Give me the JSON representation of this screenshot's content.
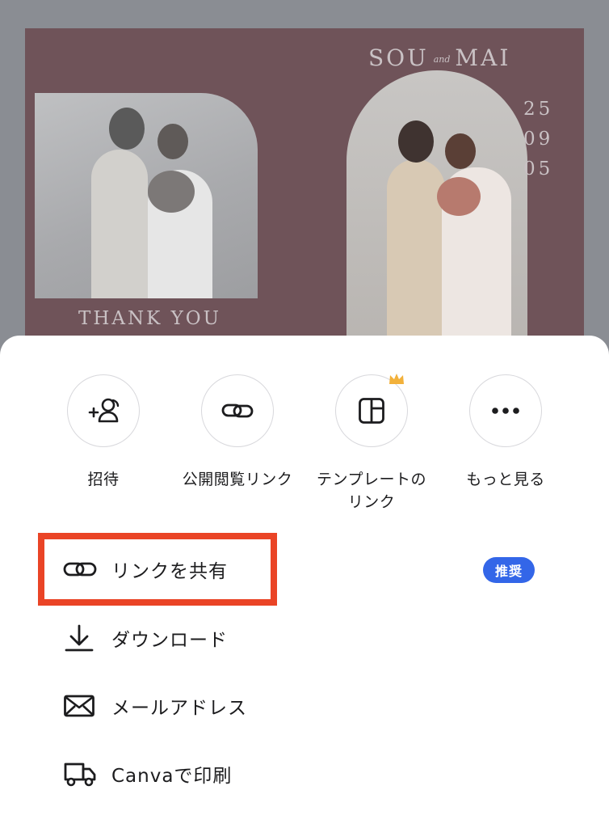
{
  "preview": {
    "names_left": "SOU",
    "names_and": "and",
    "names_right": "MAI",
    "date": "25\n09\n05",
    "thanks": "THANK YOU"
  },
  "share_targets": [
    {
      "label": "招待",
      "icon": "invite-person-icon"
    },
    {
      "label": "公開閲覧リンク",
      "icon": "link-icon"
    },
    {
      "label": "テンプレートの\nリンク",
      "icon": "template-icon",
      "premium": true
    },
    {
      "label": "もっと見る",
      "icon": "more-icon"
    }
  ],
  "actions": [
    {
      "label": "リンクを共有",
      "icon": "link-icon",
      "badge": "推奨"
    },
    {
      "label": "ダウンロード",
      "icon": "download-icon"
    },
    {
      "label": "メールアドレス",
      "icon": "mail-icon"
    },
    {
      "label": "Canvaで印刷",
      "icon": "truck-icon"
    }
  ],
  "colors": {
    "highlight": "#ea4426",
    "badge": "#3366e8",
    "crown": "#f2b13b"
  }
}
